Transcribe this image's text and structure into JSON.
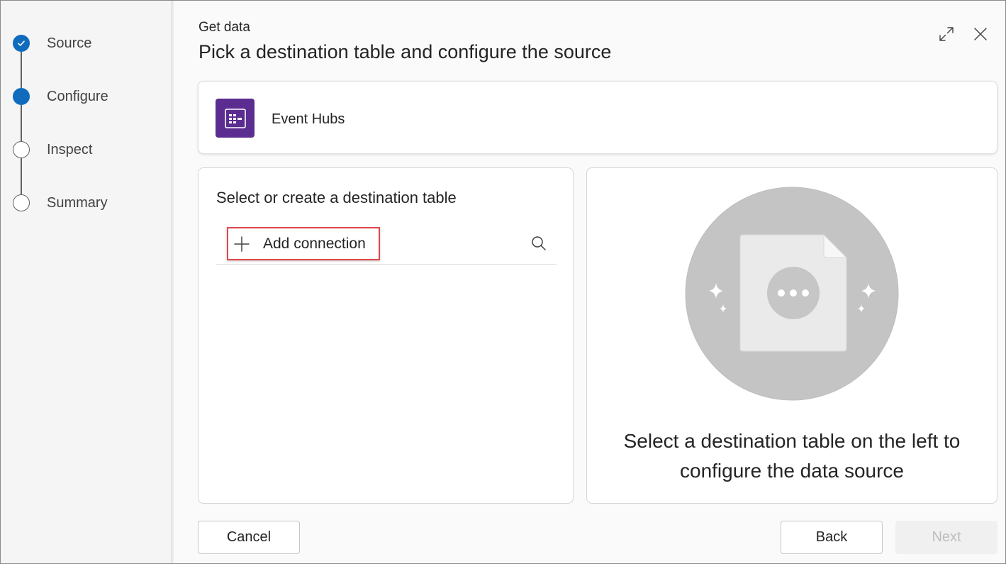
{
  "steps": [
    {
      "label": "Source",
      "state": "done"
    },
    {
      "label": "Configure",
      "state": "current"
    },
    {
      "label": "Inspect",
      "state": "pending"
    },
    {
      "label": "Summary",
      "state": "pending"
    }
  ],
  "header": {
    "kicker": "Get data",
    "title": "Pick a destination table and configure the source",
    "expand_icon": "expand-icon",
    "close_icon": "close-icon"
  },
  "source": {
    "name": "Event Hubs",
    "icon": "event-hubs-icon",
    "icon_color": "#5c2d91"
  },
  "left_panel": {
    "heading": "Select or create a destination table",
    "add_connection_label": "Add connection",
    "add_icon": "plus-icon",
    "search_icon": "search-icon"
  },
  "right_panel": {
    "illustration": "empty-document-illustration",
    "message": "Select a destination table on the left to configure the data source"
  },
  "footer": {
    "cancel_label": "Cancel",
    "back_label": "Back",
    "next_label": "Next",
    "next_disabled": true
  },
  "colors": {
    "accent": "#0f6cbd",
    "highlight": "#e0474c"
  }
}
